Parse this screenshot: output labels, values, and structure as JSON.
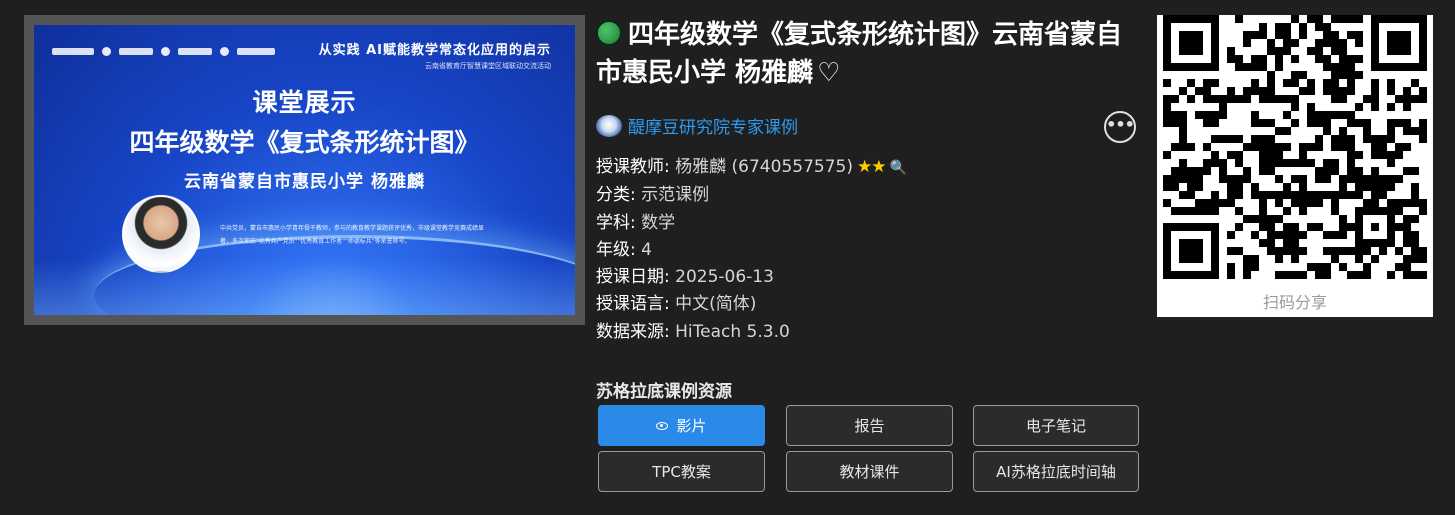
{
  "thumbnail": {
    "corner_main": "从实践 AI赋能教学常态化应用的启示",
    "corner_sub": "云南省教育厅智慧课堂区域联动交流活动",
    "line1": "课堂展示",
    "line2": "四年级数学《复式条形统计图》",
    "line3": "云南省蒙自市惠民小学  杨雅麟",
    "bio": "中共党员，蒙自市惠民小学青年骨干教师，参与的教育教学课题获评优秀，市级课堂教学竞赛成绩显著，多次荣获\"优秀共产党员\"\"优秀教育工作者\"\"师德标兵\"等荣誉称号。"
  },
  "title": "四年级数学《复式条形统计图》云南省蒙自市惠民小学 杨雅麟",
  "heart_glyph": "♡",
  "source": "醍摩豆研究院专家课例",
  "more_glyph": "•••",
  "meta": [
    {
      "label": "授课教师: ",
      "value": "杨雅麟 (6740557575)"
    },
    {
      "label": "分类: ",
      "value": "示范课例"
    },
    {
      "label": "学科: ",
      "value": "数学"
    },
    {
      "label": "年级: ",
      "value": "4"
    },
    {
      "label": "授课日期: ",
      "value": "2025-06-13"
    },
    {
      "label": "授课语言: ",
      "value": "中文(简体)"
    },
    {
      "label": "数据来源: ",
      "value": "HiTeach 5.3.0"
    }
  ],
  "rating": "★★",
  "magnify_glyph": "🔍",
  "resources_heading": "苏格拉底课例资源",
  "buttons": [
    {
      "label": "影片",
      "active": true
    },
    {
      "label": "报告"
    },
    {
      "label": "电子笔记"
    },
    {
      "label": "TPC教案"
    },
    {
      "label": "教材课件"
    },
    {
      "label": "AI苏格拉底时间轴"
    }
  ],
  "qr_caption": "扫码分享",
  "colors": {
    "accent": "#2b8ae8",
    "link": "#2f9bef",
    "star": "#ffcc00",
    "background": "#1f1f1f"
  }
}
